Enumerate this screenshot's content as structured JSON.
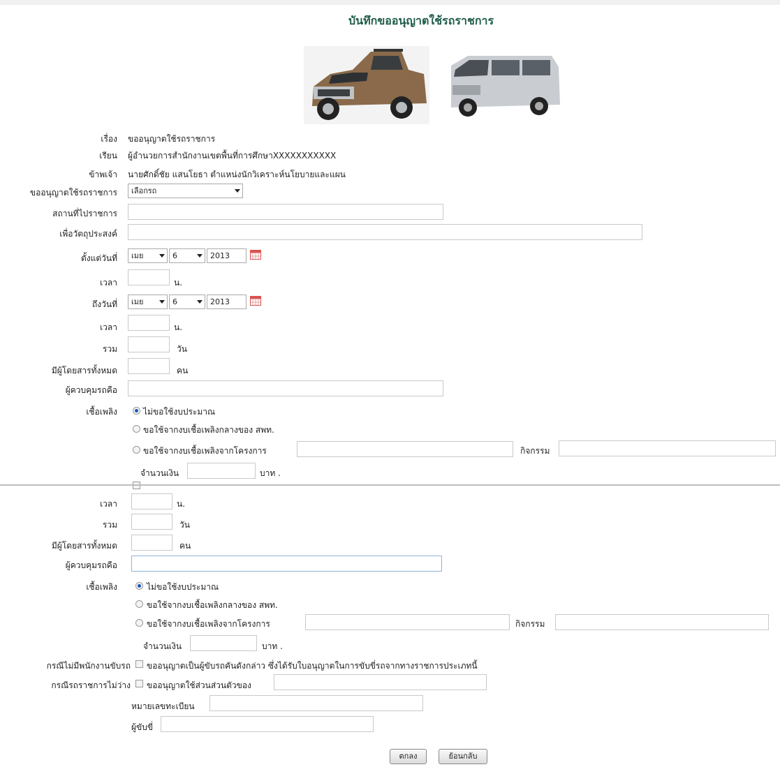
{
  "page": {
    "title": "บันทึกขออนุญาตใช้รถราชการ"
  },
  "header_info": {
    "subject_label": "เรื่อง",
    "subject_value": "ขออนุญาตใช้รถราชการ",
    "to_label": "เรียน",
    "to_value": "ผู้อำนวยการสำนักงานเขตพื้นที่การศึกษาXXXXXXXXXXX",
    "name_label": "ข้าพเจ้า",
    "name_value": "นายศักดิ์ชัย  แสนโยธา  ตำแหน่งนักวิเคราะห์นโยบายและแผน"
  },
  "form": {
    "vehicle_label": "ขออนุญาตใช้รถราชการ",
    "vehicle_select": "เลือกรถ",
    "place_label": "สถานที่ไปราชการ",
    "purpose_label": "เพื่อวัตถุประสงค์",
    "from_date_label": "ตั้งแต่วันที่",
    "to_date_label": "ถึงวันที่",
    "month": "เมย",
    "day": "6",
    "year": "2013",
    "time_label": "เวลา",
    "time_unit": "น.",
    "total_label": "รวม",
    "total_unit": "วัน",
    "passengers_label": "มีผู้โดยสารทั้งหมด",
    "passengers_unit": "คน",
    "controller_label": "ผู้ควบคุมรถคือ",
    "fuel_label": "เชื้อเพลิง",
    "fuel_opt1": "ไม่ขอใช้งบประมาณ",
    "fuel_opt2": "ขอใช้จากงบเชื้อเพลิงกลางของ สพท.",
    "fuel_opt3": "ขอใช้จากงบเชื้อเพลิงจากโครงการ",
    "activity_label": "กิจกรรม",
    "amount_label": "จำนวนเงิน",
    "amount_unit": "บาท .",
    "no_driver_label": "กรณีไม่มีพนักงานขับรถ",
    "no_driver_text": "ขออนุญาตเป็นผู้ขับรถคันดังกล่าว ซึ่งได้รับใบอนุญาตในการขับขี่รถจากทางราชการประเภทนี้",
    "car_busy_label": "กรณีรถราชการไม่ว่าง",
    "car_busy_text": "ขออนุญาตใช้ส่วนส่วนตัวของ",
    "plate_label": "หมายเลขทะเบียน",
    "driver_label": "ผู้ขับขี่"
  },
  "buttons": {
    "ok": "ตกลง",
    "back": "ย้อนกลับ"
  },
  "icons": {
    "calendar": "calendar-icon",
    "truck": "pickup-truck-image",
    "van": "van-image"
  },
  "colors": {
    "title": "#1f5c4a",
    "radio_selected": "#1a57b8",
    "calendar": "#d9534f"
  }
}
